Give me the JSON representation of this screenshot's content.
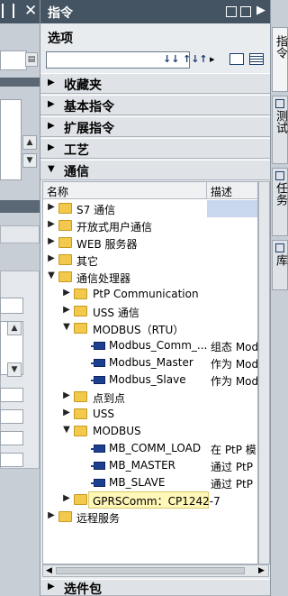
{
  "panel": {
    "title": "指令",
    "options_label": "选项",
    "search": {
      "value": "",
      "placeholder": ""
    },
    "toolbar": {
      "btn1": "↓↓",
      "btn2": "↑↓↑",
      "more": "▸"
    }
  },
  "categories": {
    "favorites": "收藏夹",
    "basic": "基本指令",
    "extended": "扩展指令",
    "technology": "工艺",
    "communication": "通信",
    "optional": "选件包"
  },
  "tree": {
    "col_name": "名称",
    "col_desc": "描述",
    "rows": [
      {
        "label": "S7 通信",
        "desc": ""
      },
      {
        "label": "开放式用户通信",
        "desc": ""
      },
      {
        "label": "WEB 服务器",
        "desc": ""
      },
      {
        "label": "其它",
        "desc": ""
      },
      {
        "label": "通信处理器",
        "desc": ""
      },
      {
        "label": "PtP Communication",
        "desc": ""
      },
      {
        "label": "USS 通信",
        "desc": ""
      },
      {
        "label": "MODBUS（RTU）",
        "desc": ""
      },
      {
        "label": "Modbus_Comm_...",
        "desc": "组态 Mod..."
      },
      {
        "label": "Modbus_Master",
        "desc": "作为 Mod..."
      },
      {
        "label": "Modbus_Slave",
        "desc": "作为 Mod..."
      },
      {
        "label": "点到点",
        "desc": ""
      },
      {
        "label": "USS",
        "desc": ""
      },
      {
        "label": "MODBUS",
        "desc": ""
      },
      {
        "label": "MB_COMM_LOAD",
        "desc": "在 PtP 模..."
      },
      {
        "label": "MB_MASTER",
        "desc": "通过 PtP ..."
      },
      {
        "label": "MB_SLAVE",
        "desc": "通过 PtP ..."
      },
      {
        "label": "GPRSComm：CP1242-7",
        "desc": ""
      },
      {
        "label": "远程服务",
        "desc": ""
      }
    ]
  },
  "side_tabs": {
    "instructions": "指令",
    "test": "测试",
    "tasks": "任务",
    "libraries": "库"
  }
}
